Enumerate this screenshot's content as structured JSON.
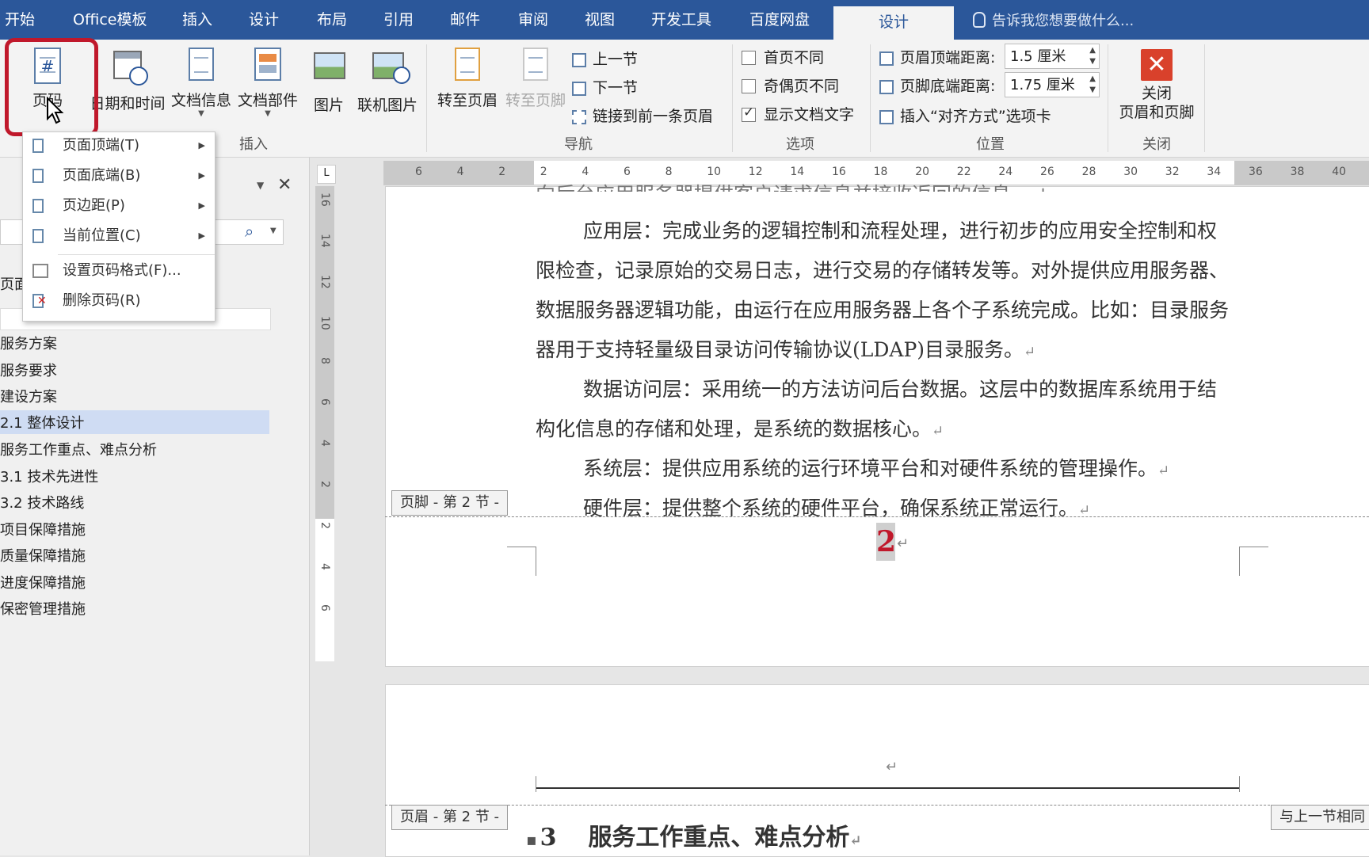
{
  "tabs": [
    {
      "label": "开始"
    },
    {
      "label": "Office模板"
    },
    {
      "label": "插入"
    },
    {
      "label": "设计"
    },
    {
      "label": "布局"
    },
    {
      "label": "引用"
    },
    {
      "label": "邮件"
    },
    {
      "label": "审阅"
    },
    {
      "label": "视图"
    },
    {
      "label": "开发工具"
    },
    {
      "label": "百度网盘"
    },
    {
      "label": "设计"
    }
  ],
  "tell_me": "告诉我您想要做什么...",
  "ribbon": {
    "insert_group": {
      "page_number": "页码",
      "date_time": "日期和时间",
      "doc_info": "文档信息",
      "quick_parts": "文档部件",
      "pictures": "图片",
      "online_pictures": "联机图片",
      "label": "插入"
    },
    "nav_group": {
      "goto_header": "转至页眉",
      "goto_footer": "转至页脚",
      "previous": "上一节",
      "next": "下一节",
      "link_previous": "链接到前一条页眉",
      "label": "导航"
    },
    "options_group": {
      "diff_first": "首页不同",
      "diff_odd_even": "奇偶页不同",
      "show_doc_text": "显示文档文字",
      "label": "选项"
    },
    "position_group": {
      "header_top_label": "页眉顶端距离:",
      "header_top_value": "1.5 厘米",
      "footer_bottom_label": "页脚底端距离:",
      "footer_bottom_value": "1.75 厘米",
      "insert_align_tab": "插入“对齐方式”选项卡",
      "label": "位置"
    },
    "close_group": {
      "close_line1": "关闭",
      "close_line2": "页眉和页脚",
      "label": "关闭"
    }
  },
  "dropdown": {
    "top_of_page": "页面顶端(T)",
    "bottom_of_page": "页面底端(B)",
    "page_margins": "页边距(P)",
    "current_position": "当前位置(C)",
    "format_page_numbers": "设置页码格式(F)...",
    "remove_page_numbers": "删除页码(R)"
  },
  "nav_pane": {
    "partial_label": "页面",
    "items": [
      {
        "label": "服务方案"
      },
      {
        "label": "服务要求"
      },
      {
        "label": "建设方案"
      },
      {
        "label": "2.1 整体设计"
      },
      {
        "label": "服务工作重点、难点分析"
      },
      {
        "label": "3.1 技术先进性"
      },
      {
        "label": "3.2 技术路线"
      },
      {
        "label": "项目保障措施"
      },
      {
        "label": "质量保障措施"
      },
      {
        "label": "进度保障措施"
      },
      {
        "label": "保密管理措施"
      }
    ]
  },
  "hruler_ticks": [
    "6",
    "4",
    "2",
    "2",
    "4",
    "6",
    "8",
    "10",
    "12",
    "14",
    "16",
    "18",
    "20",
    "22",
    "24",
    "26",
    "28",
    "30",
    "32",
    "34",
    "36",
    "38",
    "40"
  ],
  "vruler_ticks": [
    "16",
    "14",
    "12",
    "10",
    "8",
    "6",
    "4",
    "2",
    "2",
    "4",
    "6"
  ],
  "document": {
    "partial_top_line": "向后台应用服务器提供客户请求信息并接收返回的信息。↵",
    "para_app_1": "应用层：完成业务的逻辑控制和流程处理，进行初步的应用安全控制和权",
    "para_app_2": "限检查，记录原始的交易日志，进行交易的存储转发等。对外提供应用服务器、",
    "para_app_3": "数据服务器逻辑功能，由运行在应用服务器上各个子系统完成。比如：目录服务",
    "para_app_4": "器用于支持轻量级目录访问传输协议(LDAP)目录服务。",
    "para_data_1": "数据访问层：采用统一的方法访问后台数据。这层中的数据库系统用于结",
    "para_data_2": "构化信息的存储和处理，是系统的数据核心。",
    "para_sys": "系统层：提供应用系统的运行环境平台和对硬件系统的管理操作。",
    "para_hw": "硬件层：提供整个系统的硬件平台，确保系统正常运行。",
    "return_mark": "↵",
    "footer_tag": "页脚 - 第 2 节 -",
    "page_number": "2",
    "header_tag": "页眉 - 第 2 节 -",
    "same_as_previous": "与上一节相同",
    "heading_num": "3",
    "heading_text": "服务工作重点、难点分析"
  },
  "colors": {
    "tab_bar": "#2b579a",
    "highlight_box": "#c0182b",
    "close_button": "#d9412b",
    "selected_nav": "#cfdcf3"
  }
}
